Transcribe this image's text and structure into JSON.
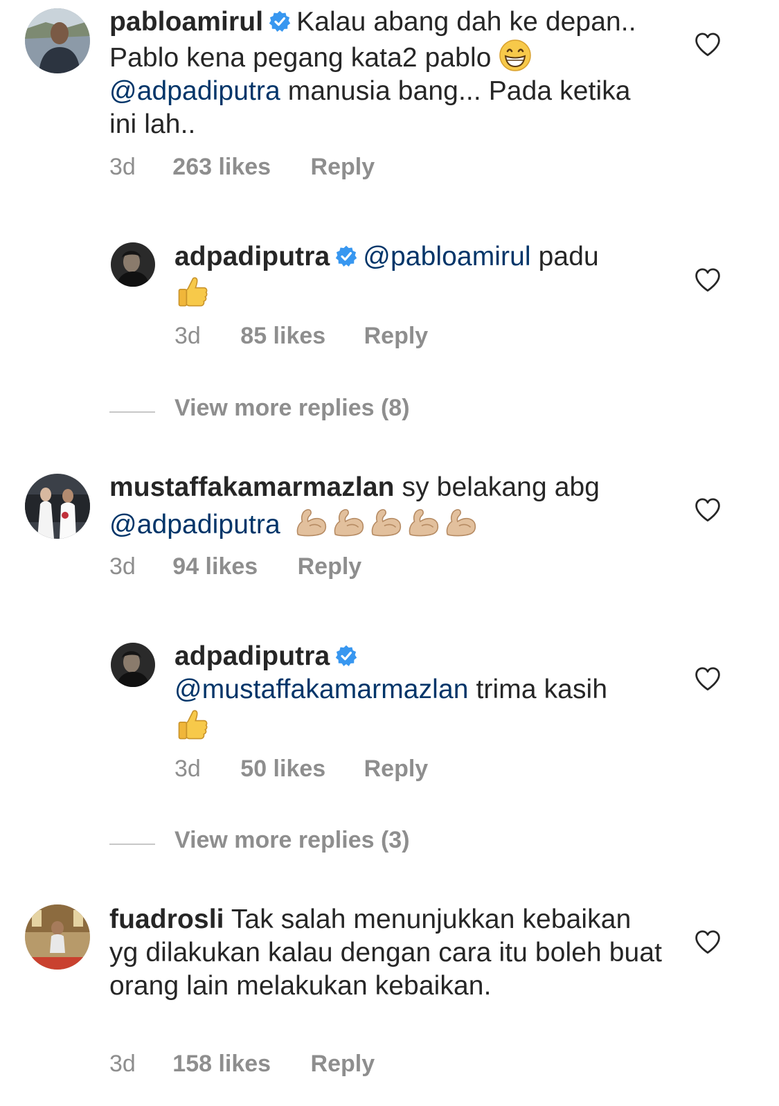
{
  "comments": [
    {
      "username": "pabloamirul",
      "verified": true,
      "text_1": "Kalau abang dah ke depan.. Pablo kena pegang kata2 pablo",
      "emoji_1": "grinning-face",
      "mention": "@adpadiputra",
      "text_2": "manusia bang... Pada ketika ini lah..",
      "time": "3d",
      "likes": "263 likes",
      "reply_label": "Reply"
    },
    {
      "username": "adpadiputra",
      "verified": true,
      "mention": "@pabloamirul",
      "text_1": "padu",
      "emoji_1": "thumbs-up",
      "time": "3d",
      "likes": "85 likes",
      "reply_label": "Reply"
    },
    {
      "username": "mustaffakamarmazlan",
      "verified": false,
      "text_1": "sy belakang abg",
      "mention": "@adpadiputra",
      "emoji_1": "flexed-biceps x5",
      "time": "3d",
      "likes": "94 likes",
      "reply_label": "Reply"
    },
    {
      "username": "adpadiputra",
      "verified": true,
      "mention": "@mustaffakamarmazlan",
      "text_1": "trima kasih",
      "emoji_1": "thumbs-up",
      "time": "3d",
      "likes": "50 likes",
      "reply_label": "Reply"
    },
    {
      "username": "fuadrosli",
      "verified": false,
      "text_1": "Tak salah menunjukkan kebaikan yg dilakukan kalau dengan cara itu boleh buat orang lain melakukan kebaikan.",
      "time": "3d",
      "likes": "158 likes",
      "reply_label": "Reply"
    }
  ],
  "view_more": [
    {
      "label": "View more replies (8)"
    },
    {
      "label": "View more replies (3)"
    }
  ],
  "colors": {
    "text": "#262626",
    "mention": "#003569",
    "meta": "#8e8e8e",
    "verified": "#3897f0"
  }
}
